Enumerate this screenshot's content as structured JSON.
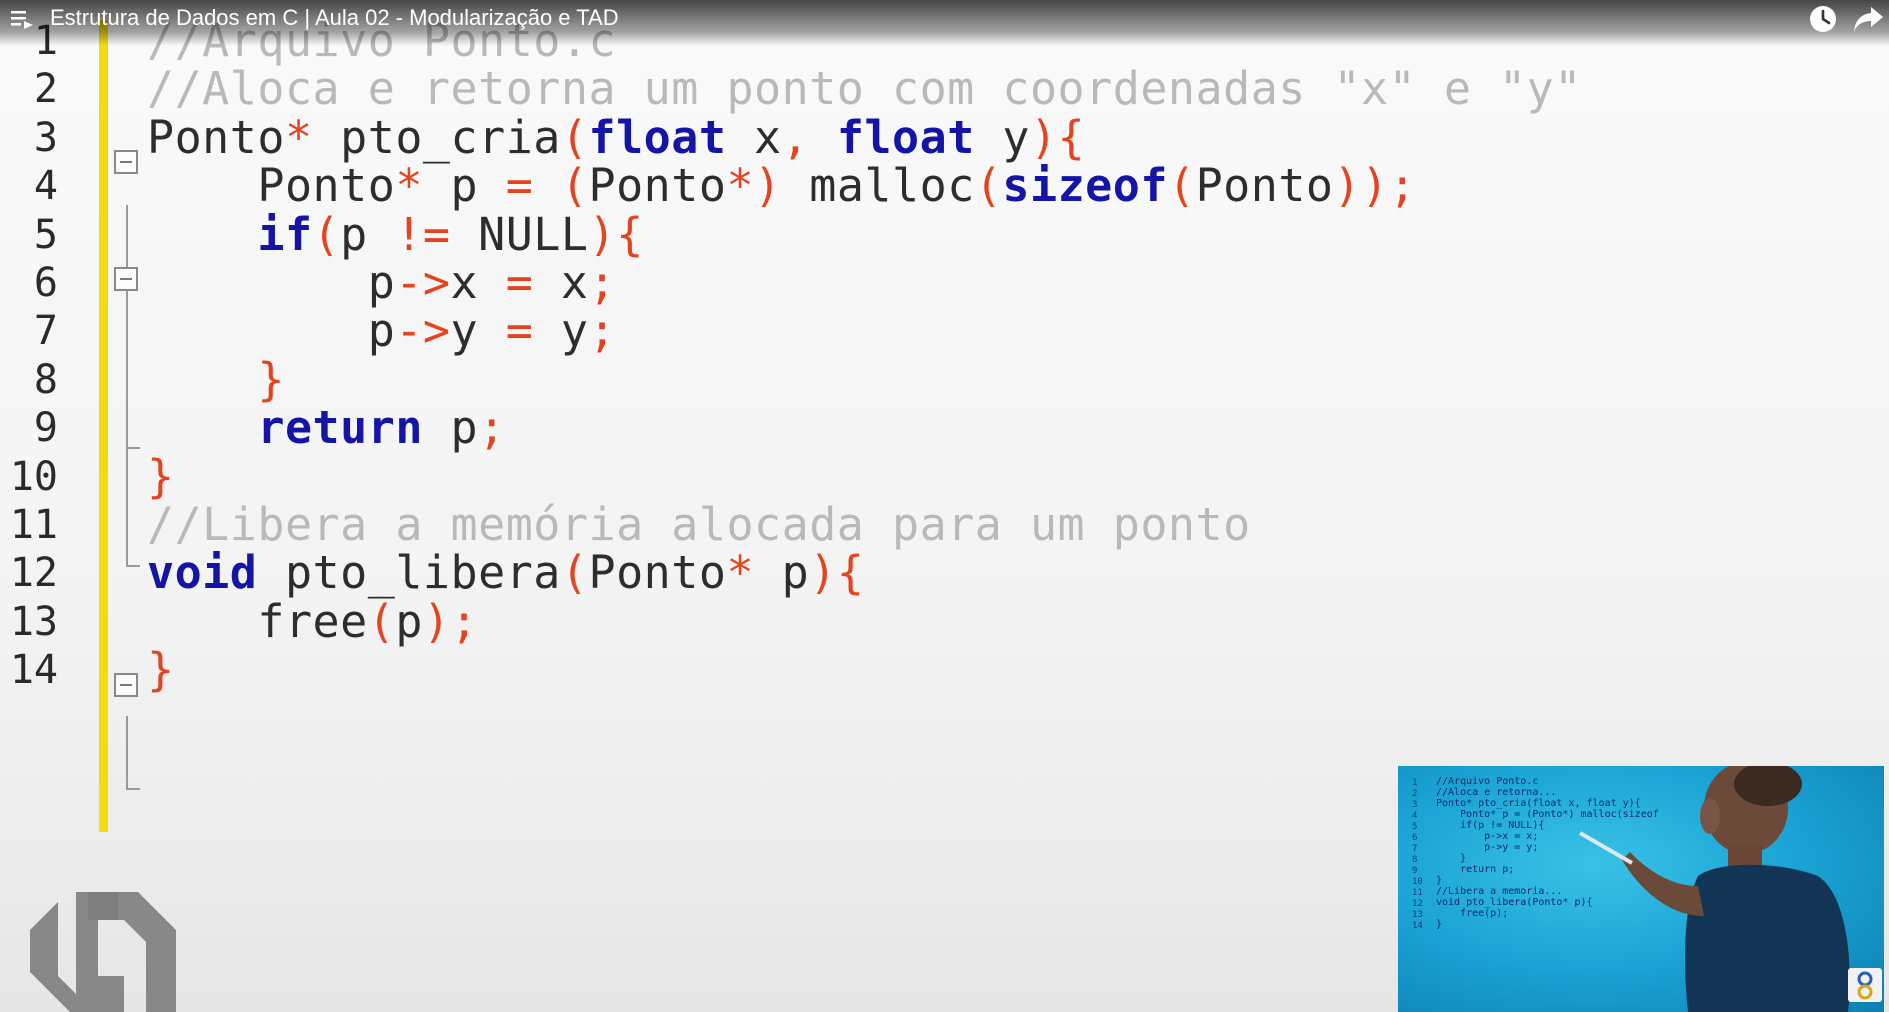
{
  "player": {
    "title": "Estrutura de Dados em C | Aula 02 - Modularização e TAD",
    "icons": {
      "playlist": "playlist-icon",
      "watch_later": "clock-icon",
      "share": "share-icon"
    }
  },
  "editor": {
    "line_numbers": [
      "1",
      "2",
      "3",
      "4",
      "5",
      "6",
      "7",
      "8",
      "9",
      "10",
      "11",
      "12",
      "13",
      "14"
    ],
    "lines": [
      [
        {
          "t": "//Arquivo Ponto.c",
          "k": "cm"
        }
      ],
      [
        {
          "t": "//Aloca e retorna um ponto com coordenadas \"x\" e \"y\"",
          "k": "cm"
        }
      ],
      [
        {
          "t": "Ponto",
          "k": "tx"
        },
        {
          "t": "*",
          "k": "op"
        },
        {
          "t": " pto_cria",
          "k": "tx"
        },
        {
          "t": "(",
          "k": "op"
        },
        {
          "t": "float",
          "k": "kw"
        },
        {
          "t": " x",
          "k": "tx"
        },
        {
          "t": ",",
          "k": "op"
        },
        {
          "t": " ",
          "k": "tx"
        },
        {
          "t": "float",
          "k": "kw"
        },
        {
          "t": " y",
          "k": "tx"
        },
        {
          "t": "){",
          "k": "op"
        }
      ],
      [
        {
          "t": "    Ponto",
          "k": "tx"
        },
        {
          "t": "*",
          "k": "op"
        },
        {
          "t": " p ",
          "k": "tx"
        },
        {
          "t": "=",
          "k": "op"
        },
        {
          "t": " ",
          "k": "tx"
        },
        {
          "t": "(",
          "k": "op"
        },
        {
          "t": "Ponto",
          "k": "tx"
        },
        {
          "t": "*)",
          "k": "op"
        },
        {
          "t": " malloc",
          "k": "tx"
        },
        {
          "t": "(",
          "k": "op"
        },
        {
          "t": "sizeof",
          "k": "kw"
        },
        {
          "t": "(",
          "k": "op"
        },
        {
          "t": "Ponto",
          "k": "tx"
        },
        {
          "t": "));",
          "k": "op"
        }
      ],
      [
        {
          "t": "    ",
          "k": "tx"
        },
        {
          "t": "if",
          "k": "kw"
        },
        {
          "t": "(",
          "k": "op"
        },
        {
          "t": "p ",
          "k": "tx"
        },
        {
          "t": "!=",
          "k": "op"
        },
        {
          "t": " NULL",
          "k": "tx"
        },
        {
          "t": "){",
          "k": "op"
        }
      ],
      [
        {
          "t": "        p",
          "k": "tx"
        },
        {
          "t": "->",
          "k": "op"
        },
        {
          "t": "x ",
          "k": "tx"
        },
        {
          "t": "=",
          "k": "op"
        },
        {
          "t": " x",
          "k": "tx"
        },
        {
          "t": ";",
          "k": "op"
        }
      ],
      [
        {
          "t": "        p",
          "k": "tx"
        },
        {
          "t": "->",
          "k": "op"
        },
        {
          "t": "y ",
          "k": "tx"
        },
        {
          "t": "=",
          "k": "op"
        },
        {
          "t": " y",
          "k": "tx"
        },
        {
          "t": ";",
          "k": "op"
        }
      ],
      [
        {
          "t": "    ",
          "k": "tx"
        },
        {
          "t": "}",
          "k": "op"
        }
      ],
      [
        {
          "t": "    ",
          "k": "tx"
        },
        {
          "t": "return",
          "k": "kw"
        },
        {
          "t": " p",
          "k": "tx"
        },
        {
          "t": ";",
          "k": "op"
        }
      ],
      [
        {
          "t": "}",
          "k": "op"
        }
      ],
      [
        {
          "t": "//Libera a memória alocada para um ponto",
          "k": "cm"
        }
      ],
      [
        {
          "t": "void",
          "k": "kw"
        },
        {
          "t": " pto_libera",
          "k": "tx"
        },
        {
          "t": "(",
          "k": "op"
        },
        {
          "t": "Ponto",
          "k": "tx"
        },
        {
          "t": "*",
          "k": "op"
        },
        {
          "t": " p",
          "k": "tx"
        },
        {
          "t": "){",
          "k": "op"
        }
      ],
      [
        {
          "t": "    free",
          "k": "tx"
        },
        {
          "t": "(",
          "k": "op"
        },
        {
          "t": "p",
          "k": "tx"
        },
        {
          "t": ");",
          "k": "op"
        }
      ],
      [
        {
          "t": "}",
          "k": "op"
        }
      ]
    ],
    "colors": {
      "keyword": "#1414a6",
      "operator": "#e5431f",
      "comment": "#b9b9b9",
      "text": "#2d2d2d",
      "gutter_marker": "#f2dc0c"
    }
  },
  "thumbnail": {
    "lines": [
      "//Arquivo Ponto.c",
      "//Aloca e retorna...",
      "Ponto* pto_cria(float x, float y){",
      "    Ponto* p = (Ponto*) malloc(sizeof",
      "    if(p != NULL){",
      "        p->x = x;",
      "        p->y = y;",
      "    }",
      "    return p;",
      "}",
      "//Libera a memoria...",
      "void pto_libera(Ponto* p){",
      "    free(p);",
      "}"
    ],
    "line_numbers": [
      "1",
      "2",
      "3",
      "4",
      "5",
      "6",
      "7",
      "8",
      "9",
      "10",
      "11",
      "12",
      "13",
      "14"
    ]
  }
}
